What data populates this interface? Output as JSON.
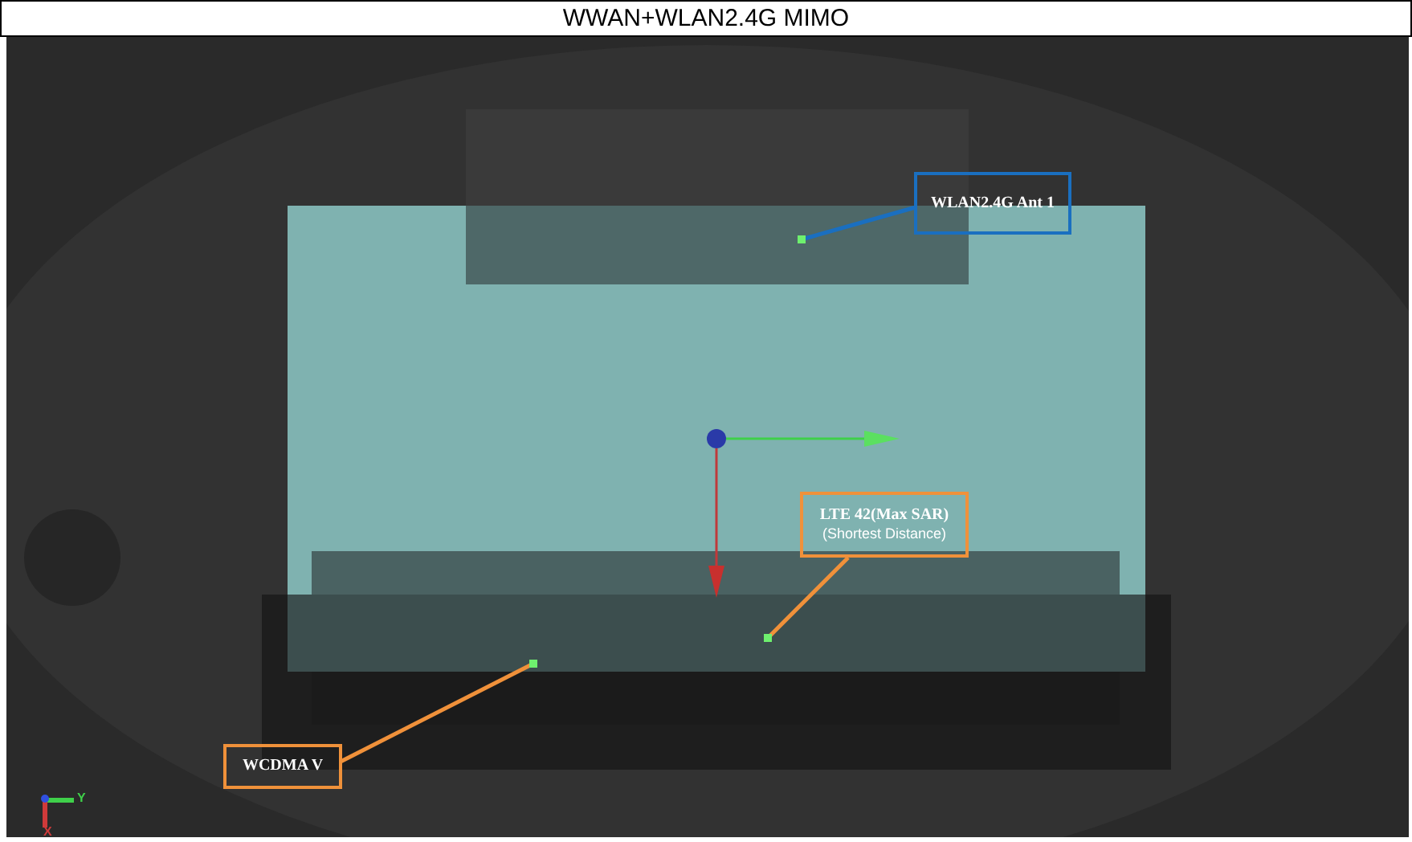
{
  "title": "WWAN+WLAN2.4G MIMO",
  "annotations": [
    {
      "label": "WLAN2.4G Ant 1",
      "color": "#1a6fc0"
    },
    {
      "label": "LTE 42(Max SAR)",
      "note": "(Shortest Distance)",
      "color": "#f0913a"
    },
    {
      "label": "WCDMA V",
      "color": "#f0913a"
    }
  ],
  "axis_labels": [
    "Y",
    "X"
  ]
}
